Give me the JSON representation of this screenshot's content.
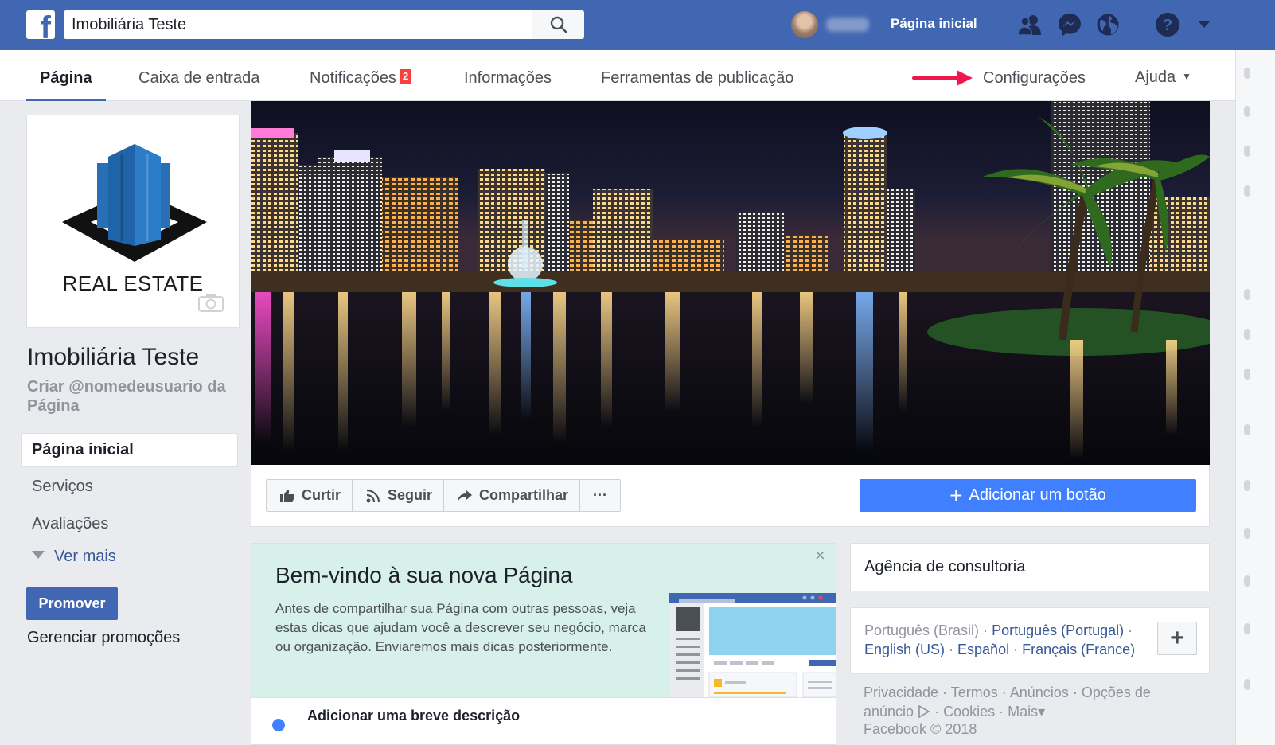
{
  "topbar": {
    "search_value": "Imobiliária Teste",
    "home_label": "Página inicial",
    "icons": [
      "friends-icon",
      "messenger-icon",
      "globe-icon",
      "help-icon",
      "caret-down-icon"
    ],
    "brand_color": "#4267b2"
  },
  "nav": {
    "tabs": [
      {
        "label": "Página"
      },
      {
        "label": "Caixa de entrada"
      },
      {
        "label": "Notificações",
        "badge": "2"
      },
      {
        "label": "Informações"
      },
      {
        "label": "Ferramentas de publicação"
      },
      {
        "label": "Configurações"
      },
      {
        "label": "Ajuda"
      }
    ],
    "help_caret": "▼",
    "annotation_arrow_color": "#f0174f"
  },
  "profile": {
    "logo_text": "REAL ESTATE",
    "page_name": "Imobiliária Teste",
    "username_prompt": "Criar @nomedeusuario da Página"
  },
  "left_nav": {
    "items": [
      {
        "label": "Página inicial"
      },
      {
        "label": "Serviços"
      },
      {
        "label": "Avaliações"
      }
    ],
    "see_more": "Ver mais",
    "promote": "Promover",
    "manage_promotions": "Gerenciar promoções"
  },
  "actions": {
    "like": "Curtir",
    "follow": "Seguir",
    "share": "Compartilhar",
    "more": "···",
    "add_button": "Adicionar um botão",
    "add_button_color": "#4080ff"
  },
  "welcome": {
    "title": "Bem-vindo à sua nova Página",
    "body": "Antes de compartilhar sua Página com outras pessoas, veja estas dicas que ajudam você a descrever seu negócio, marca ou organização. Enviaremos mais dicas posteriormente.",
    "close": "×",
    "first_tip": "Adicionar uma breve descrição"
  },
  "sidebar_right": {
    "category": "Agência de consultoria",
    "languages": {
      "current": "Português (Brasil)",
      "options": [
        "Português (Portugal)",
        "English (US)",
        "Español",
        "Français (France)"
      ],
      "sep": " · ",
      "add": "+"
    },
    "footer_links": [
      "Privacidade",
      "Termos",
      "Anúncios",
      "Opções de anúncio",
      "Cookies",
      "Mais"
    ],
    "footer_more_caret": "▾",
    "copyright": "Facebook © 2018"
  }
}
